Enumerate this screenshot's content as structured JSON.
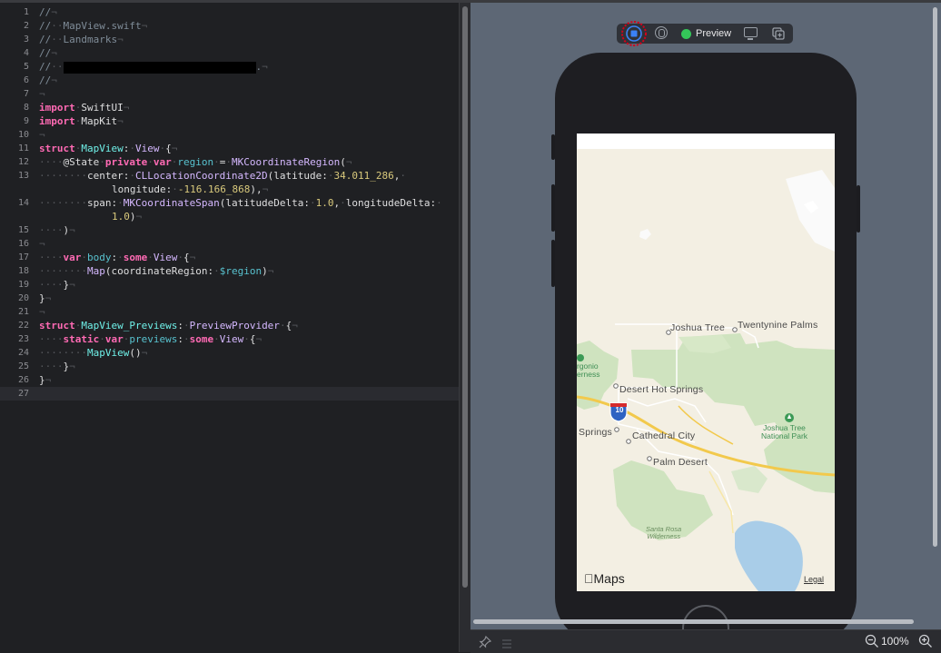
{
  "editor": {
    "lines": [
      {
        "n": "1",
        "segs": [
          {
            "c": "cm",
            "t": "//"
          },
          {
            "c": "ws",
            "t": "¬"
          }
        ]
      },
      {
        "n": "2",
        "segs": [
          {
            "c": "cm",
            "t": "//"
          },
          {
            "c": "ws",
            "t": "··"
          },
          {
            "c": "cm",
            "t": "MapView.swift"
          },
          {
            "c": "ws",
            "t": "¬"
          }
        ]
      },
      {
        "n": "3",
        "segs": [
          {
            "c": "cm",
            "t": "//"
          },
          {
            "c": "ws",
            "t": "··"
          },
          {
            "c": "cm",
            "t": "Landmarks"
          },
          {
            "c": "ws",
            "t": "¬"
          }
        ]
      },
      {
        "n": "4",
        "segs": [
          {
            "c": "cm",
            "t": "//"
          },
          {
            "c": "ws",
            "t": "¬"
          }
        ]
      },
      {
        "n": "5",
        "segs": [
          {
            "c": "cm",
            "t": "//"
          },
          {
            "c": "ws",
            "t": "··"
          },
          {
            "c": "redact",
            "t": ""
          },
          {
            "c": "cm",
            "t": "."
          },
          {
            "c": "ws",
            "t": "¬"
          }
        ]
      },
      {
        "n": "6",
        "segs": [
          {
            "c": "cm",
            "t": "//"
          },
          {
            "c": "ws",
            "t": "¬"
          }
        ]
      },
      {
        "n": "7",
        "segs": [
          {
            "c": "ws",
            "t": "¬"
          }
        ]
      },
      {
        "n": "8",
        "segs": [
          {
            "c": "kw",
            "t": "import"
          },
          {
            "c": "ws",
            "t": "·"
          },
          {
            "c": "",
            "t": "SwiftUI"
          },
          {
            "c": "ws",
            "t": "¬"
          }
        ]
      },
      {
        "n": "9",
        "segs": [
          {
            "c": "kw",
            "t": "import"
          },
          {
            "c": "ws",
            "t": "·"
          },
          {
            "c": "",
            "t": "MapKit"
          },
          {
            "c": "ws",
            "t": "¬"
          }
        ]
      },
      {
        "n": "10",
        "segs": [
          {
            "c": "ws",
            "t": "¬"
          }
        ]
      },
      {
        "n": "11",
        "segs": [
          {
            "c": "kw",
            "t": "struct"
          },
          {
            "c": "ws",
            "t": "·"
          },
          {
            "c": "tyd",
            "t": "MapView"
          },
          {
            "c": "",
            "t": ":"
          },
          {
            "c": "ws",
            "t": "·"
          },
          {
            "c": "ty",
            "t": "View"
          },
          {
            "c": "ws",
            "t": "·"
          },
          {
            "c": "",
            "t": "{"
          },
          {
            "c": "ws",
            "t": "¬"
          }
        ]
      },
      {
        "n": "12",
        "segs": [
          {
            "c": "ws",
            "t": "····"
          },
          {
            "c": "",
            "t": "@State"
          },
          {
            "c": "ws",
            "t": "·"
          },
          {
            "c": "kw",
            "t": "private"
          },
          {
            "c": "ws",
            "t": "·"
          },
          {
            "c": "kw",
            "t": "var"
          },
          {
            "c": "ws",
            "t": "·"
          },
          {
            "c": "pv",
            "t": "region"
          },
          {
            "c": "ws",
            "t": "·"
          },
          {
            "c": "",
            "t": "="
          },
          {
            "c": "ws",
            "t": "·"
          },
          {
            "c": "ty",
            "t": "MKCoordinateRegion"
          },
          {
            "c": "",
            "t": "("
          },
          {
            "c": "ws",
            "t": "¬"
          }
        ]
      },
      {
        "n": "13",
        "segs": [
          {
            "c": "ws",
            "t": "········"
          },
          {
            "c": "",
            "t": "center:"
          },
          {
            "c": "ws",
            "t": "·"
          },
          {
            "c": "ty",
            "t": "CLLocationCoordinate2D"
          },
          {
            "c": "",
            "t": "(latitude:"
          },
          {
            "c": "ws",
            "t": "·"
          },
          {
            "c": "num",
            "t": "34.011_286"
          },
          {
            "c": "",
            "t": ","
          },
          {
            "c": "ws",
            "t": "·"
          }
        ],
        "cont": [
          {
            "c": "",
            "t": "longitude:"
          },
          {
            "c": "ws",
            "t": "·"
          },
          {
            "c": "num",
            "t": "-116.166_868"
          },
          {
            "c": "",
            "t": "),"
          },
          {
            "c": "ws",
            "t": "¬"
          }
        ]
      },
      {
        "n": "14",
        "segs": [
          {
            "c": "ws",
            "t": "········"
          },
          {
            "c": "",
            "t": "span:"
          },
          {
            "c": "ws",
            "t": "·"
          },
          {
            "c": "ty",
            "t": "MKCoordinateSpan"
          },
          {
            "c": "",
            "t": "(latitudeDelta:"
          },
          {
            "c": "ws",
            "t": "·"
          },
          {
            "c": "num",
            "t": "1.0"
          },
          {
            "c": "",
            "t": ","
          },
          {
            "c": "ws",
            "t": "·"
          },
          {
            "c": "",
            "t": "longitudeDelta:"
          },
          {
            "c": "ws",
            "t": "·"
          }
        ],
        "cont2": [
          {
            "c": "num",
            "t": "1.0"
          },
          {
            "c": "",
            "t": ")"
          },
          {
            "c": "ws",
            "t": "¬"
          }
        ]
      },
      {
        "n": "15",
        "segs": [
          {
            "c": "ws",
            "t": "····"
          },
          {
            "c": "",
            "t": ")"
          },
          {
            "c": "ws",
            "t": "¬"
          }
        ]
      },
      {
        "n": "16",
        "segs": [
          {
            "c": "ws",
            "t": "¬"
          }
        ]
      },
      {
        "n": "17",
        "segs": [
          {
            "c": "ws",
            "t": "····"
          },
          {
            "c": "kw",
            "t": "var"
          },
          {
            "c": "ws",
            "t": "·"
          },
          {
            "c": "pv",
            "t": "body"
          },
          {
            "c": "",
            "t": ":"
          },
          {
            "c": "ws",
            "t": "·"
          },
          {
            "c": "kw",
            "t": "some"
          },
          {
            "c": "ws",
            "t": "·"
          },
          {
            "c": "ty",
            "t": "View"
          },
          {
            "c": "ws",
            "t": "·"
          },
          {
            "c": "",
            "t": "{"
          },
          {
            "c": "ws",
            "t": "¬"
          }
        ]
      },
      {
        "n": "18",
        "segs": [
          {
            "c": "ws",
            "t": "········"
          },
          {
            "c": "ty",
            "t": "Map"
          },
          {
            "c": "",
            "t": "(coordinateRegion:"
          },
          {
            "c": "ws",
            "t": "·"
          },
          {
            "c": "pv",
            "t": "$region"
          },
          {
            "c": "",
            "t": ")"
          },
          {
            "c": "ws",
            "t": "¬"
          }
        ]
      },
      {
        "n": "19",
        "segs": [
          {
            "c": "ws",
            "t": "····"
          },
          {
            "c": "",
            "t": "}"
          },
          {
            "c": "ws",
            "t": "¬"
          }
        ]
      },
      {
        "n": "20",
        "segs": [
          {
            "c": "",
            "t": "}"
          },
          {
            "c": "ws",
            "t": "¬"
          }
        ]
      },
      {
        "n": "21",
        "segs": [
          {
            "c": "ws",
            "t": "¬"
          }
        ]
      },
      {
        "n": "22",
        "segs": [
          {
            "c": "kw",
            "t": "struct"
          },
          {
            "c": "ws",
            "t": "·"
          },
          {
            "c": "tyd",
            "t": "MapView_Previews"
          },
          {
            "c": "",
            "t": ":"
          },
          {
            "c": "ws",
            "t": "·"
          },
          {
            "c": "ty",
            "t": "PreviewProvider"
          },
          {
            "c": "ws",
            "t": "·"
          },
          {
            "c": "",
            "t": "{"
          },
          {
            "c": "ws",
            "t": "¬"
          }
        ]
      },
      {
        "n": "23",
        "segs": [
          {
            "c": "ws",
            "t": "····"
          },
          {
            "c": "kw",
            "t": "static"
          },
          {
            "c": "ws",
            "t": "·"
          },
          {
            "c": "kw",
            "t": "var"
          },
          {
            "c": "ws",
            "t": "·"
          },
          {
            "c": "pv",
            "t": "previews"
          },
          {
            "c": "",
            "t": ":"
          },
          {
            "c": "ws",
            "t": "·"
          },
          {
            "c": "kw",
            "t": "some"
          },
          {
            "c": "ws",
            "t": "·"
          },
          {
            "c": "ty",
            "t": "View"
          },
          {
            "c": "ws",
            "t": "·"
          },
          {
            "c": "",
            "t": "{"
          },
          {
            "c": "ws",
            "t": "¬"
          }
        ]
      },
      {
        "n": "24",
        "segs": [
          {
            "c": "ws",
            "t": "········"
          },
          {
            "c": "tyd",
            "t": "MapView"
          },
          {
            "c": "",
            "t": "()"
          },
          {
            "c": "ws",
            "t": "¬"
          }
        ]
      },
      {
        "n": "25",
        "segs": [
          {
            "c": "ws",
            "t": "····"
          },
          {
            "c": "",
            "t": "}"
          },
          {
            "c": "ws",
            "t": "¬"
          }
        ]
      },
      {
        "n": "26",
        "segs": [
          {
            "c": "",
            "t": "}"
          },
          {
            "c": "ws",
            "t": "¬"
          }
        ]
      },
      {
        "n": "27",
        "segs": [],
        "current": true
      }
    ]
  },
  "preview": {
    "label": "Preview",
    "live_icon": "live-preview-icon",
    "inspect_icon": "inspect-preview-icon",
    "device_icon": "device-settings-icon",
    "duplicate_icon": "duplicate-preview-icon",
    "live_highlight_color": "#d0021b"
  },
  "map": {
    "places": [
      {
        "key": "joshua-tree",
        "label": "Joshua Tree"
      },
      {
        "key": "twentynine-palms",
        "label": "Twentynine Palms"
      },
      {
        "key": "san-gorgonio",
        "label": "rgonio\nerness"
      },
      {
        "key": "desert-hot-springs",
        "label": "Desert Hot Springs"
      },
      {
        "key": "springs",
        "label": "Springs"
      },
      {
        "key": "cathedral-city",
        "label": "Cathedral City"
      },
      {
        "key": "palm-desert",
        "label": "Palm Desert"
      },
      {
        "key": "joshua-tree-np",
        "label": "Joshua Tree\nNational Park"
      },
      {
        "key": "santa-rosa",
        "label": "Santa Rosa\nWilderness"
      }
    ],
    "interstate": "10",
    "attribution": "Maps",
    "legal": "Legal"
  },
  "bottom": {
    "zoom": "100%",
    "pin_icon": "pin-icon",
    "list_icon": "list-icon",
    "zoom_out_icon": "zoom-out-icon",
    "zoom_in_icon": "zoom-in-icon"
  }
}
